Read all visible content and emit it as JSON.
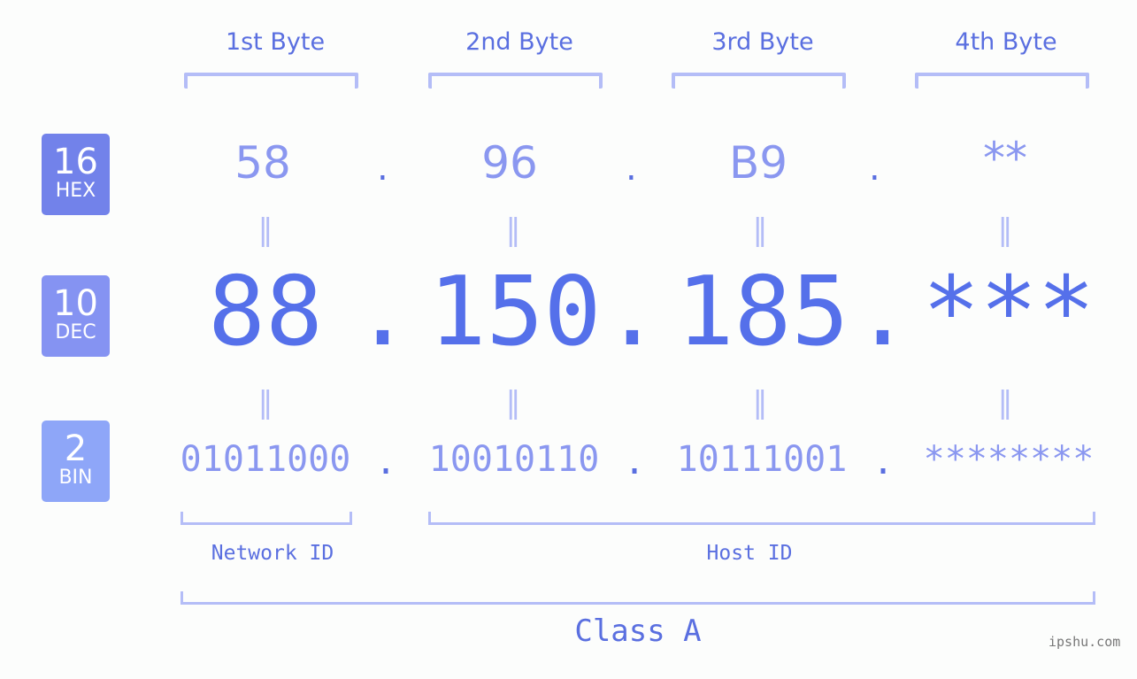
{
  "headers": [
    "1st Byte",
    "2nd Byte",
    "3rd Byte",
    "4th Byte"
  ],
  "badges": {
    "hex": {
      "num": "16",
      "label": "HEX",
      "color": "#7282ea"
    },
    "dec": {
      "num": "10",
      "label": "DEC",
      "color": "#8593f2"
    },
    "bin": {
      "num": "2",
      "label": "BIN",
      "color": "#8ea6f8"
    }
  },
  "hex": [
    "58",
    "96",
    "B9",
    "**"
  ],
  "dec": [
    "88",
    "150",
    "185",
    "***"
  ],
  "bin": [
    "01011000",
    "10010110",
    "10111001",
    "********"
  ],
  "separator": ".",
  "equals": "=",
  "network_id_label": "Network ID",
  "host_id_label": "Host ID",
  "class_label": "Class A",
  "watermark": "ipshu.com",
  "colors": {
    "accent": "#5570ea",
    "light": "#8a97f0",
    "bracket": "#b4bdf7"
  }
}
